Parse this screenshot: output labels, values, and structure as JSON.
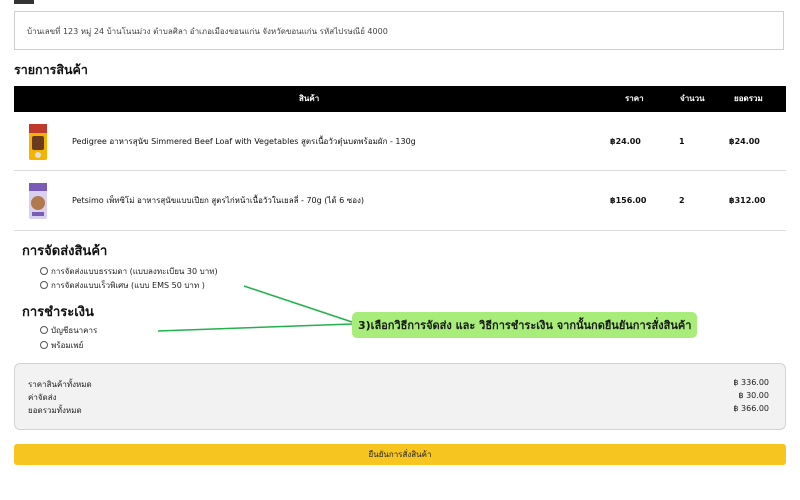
{
  "address": "บ้านเลขที่ 123 หมู่ 24 บ้านโนนม่วง ตำบลศิลา อำเภอเมืองขอนแก่น จังหวัดขอนแก่น รหัสไปรษณีย์ 4000",
  "items_section_title": "รายการสินค้า",
  "table": {
    "headers": {
      "product": "สินค้า",
      "price": "ราคา",
      "qty": "จำนวน",
      "total": "ยอดรวม"
    },
    "rows": [
      {
        "name": "Pedigree อาหารสุนัข Simmered Beef Loaf with Vegetables สูตรเนื้อวัวตุ๋นบดพร้อมผัก - 130g",
        "price": "฿24.00",
        "qty": "1",
        "total": "฿24.00",
        "image_icon": "dog-food-pouch-image"
      },
      {
        "name": "Petsimo เพ็ทซิโม่ อาหารสุนัขแบบเปียก สูตรไก่หน้าเนื้อวัวในเยลลี่ - 70g (ได้ 6 ซอง)",
        "price": "฿156.00",
        "qty": "2",
        "total": "฿312.00",
        "image_icon": "dog-food-pouch-image"
      }
    ]
  },
  "shipping": {
    "title": "การจัดส่งสินค้า",
    "options": [
      "การจัดส่งแบบธรรมดา (แบบลงทะเบียน 30 บาท)",
      "การจัดส่งแบบเร็วพิเศษ (แบบ EMS 50 บาท )"
    ]
  },
  "payment": {
    "title": "การชำระเงิน",
    "options": [
      "บัญชีธนาคาร",
      "พร้อมเพย์"
    ]
  },
  "callout": "3)เลือกวิธีการจัดส่ง และ วิธีการชำระเงิน จากนั้นกดยืนยันการสั่งสินค้า",
  "summary": {
    "subtotal_label": "ราคาสินค้าทั้งหมด",
    "subtotal": "฿ 336.00",
    "shipping_label": "ค่าจัดส่ง",
    "shipping": "฿ 30.00",
    "grand_label": "ยอดรวมทั้งหมด",
    "grand": "฿ 366.00"
  },
  "confirm_label": "ยืนยันการสั่งสินค้า",
  "colors": {
    "header_bg": "#000000",
    "confirm_bg": "#f7c51f",
    "callout_bg": "#a8ec7a",
    "arrow": "#22b14c"
  }
}
